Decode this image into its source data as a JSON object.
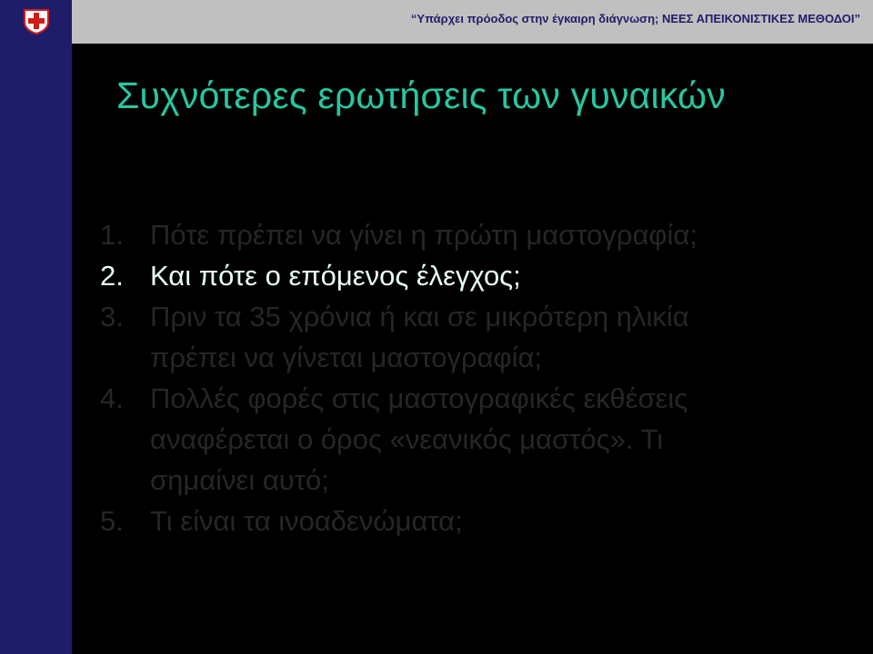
{
  "header": {
    "text": "“Υπάρχει πρόοδος στην έγκαιρη διάγνωση;  ΝΕΕΣ ΑΠΕΙΚΟΝΙΣΤΙΚΕΣ  ΜΕΘΟΔΟΙ”",
    "logo_icon": "red-cross-shield-icon"
  },
  "colors": {
    "sidebar": "#1f1d6a",
    "header_bg": "#c0c0c0",
    "title": "#28c6a0",
    "active_item": "#e6fff2",
    "inactive_item": "#262626",
    "background": "#000000"
  },
  "slide": {
    "title": "Συχνότερες ερωτήσεις των γυναικών",
    "items": [
      {
        "num": "1.",
        "text": "Πότε πρέπει να γίνει η πρώτη μαστογραφία;",
        "active": false
      },
      {
        "num": "2.",
        "text": "Και πότε ο επόμενος έλεγχος;",
        "active": true
      },
      {
        "num": "3.",
        "text": "Πριν τα 35 χρόνια ή και σε μικρότερη ηλικία\nπρέπει να γίνεται μαστογραφία;",
        "active": false
      },
      {
        "num": "4.",
        "text": "Πολλές φορές στις μαστογραφικές εκθέσεις\nαναφέρεται ο όρος «νεανικός μαστός».  Τι\nσημαίνει αυτό;",
        "active": false
      },
      {
        "num": "5.",
        "text": "Τι είναι τα ινοαδενώματα;",
        "active": false
      }
    ]
  }
}
